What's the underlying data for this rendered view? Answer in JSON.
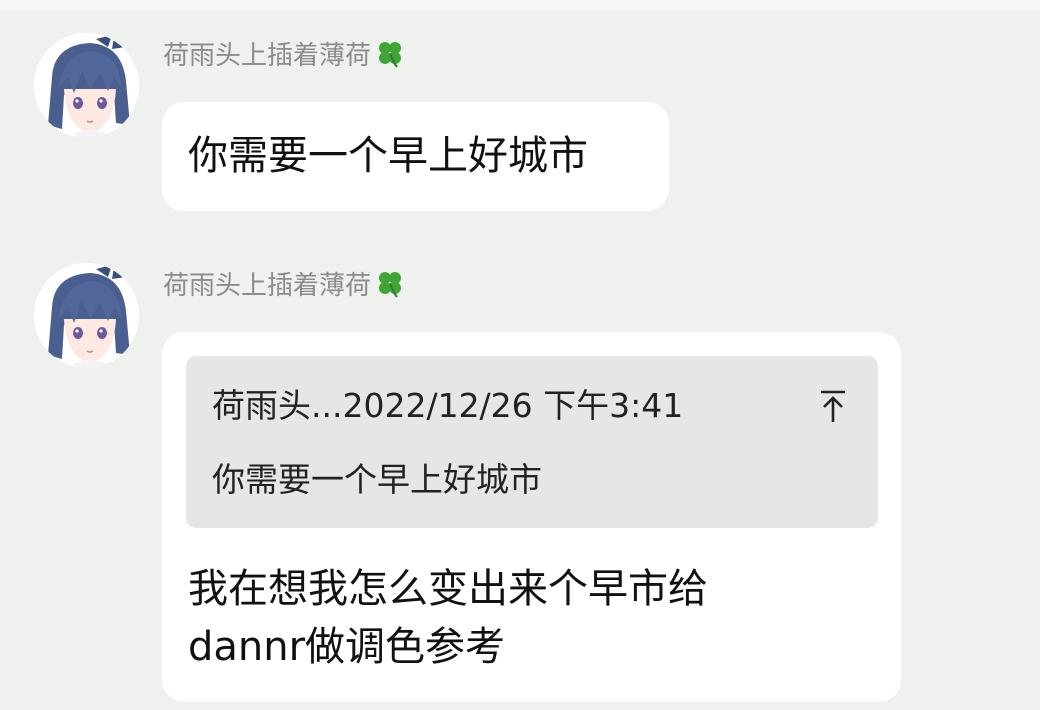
{
  "messages": [
    {
      "sender": "荷雨头上插着薄荷",
      "sender_icon": "four-leaf-clover-icon",
      "text": "你需要一个早上好城市"
    },
    {
      "sender": "荷雨头上插着薄荷",
      "sender_icon": "four-leaf-clover-icon",
      "quote": {
        "meta": "荷雨头...2022/12/26 下午3:41",
        "text": "你需要一个早上好城市",
        "icon": "jump-to-original-icon"
      },
      "text_line1": "我在想我怎么变出来个早市给",
      "text_line2": "dannr做调色参考"
    }
  ],
  "colors": {
    "background": "#eef1ed",
    "bubble": "#ffffff",
    "quote_background": "#e6e6e6",
    "sender_name": "#8c8c8c",
    "clover": "#3fa535"
  }
}
